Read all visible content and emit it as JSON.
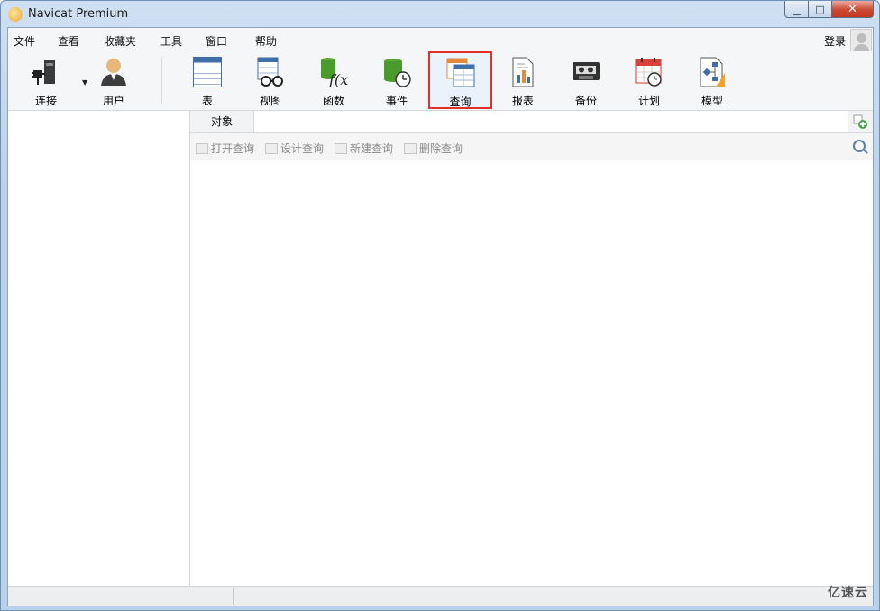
{
  "window": {
    "title": "Navicat Premium"
  },
  "menubar": {
    "items": [
      "文件",
      "查看",
      "收藏夹",
      "工具",
      "窗口",
      "帮助"
    ],
    "login_label": "登录"
  },
  "toolbar": {
    "connect": "连接",
    "user": "用户",
    "table": "表",
    "view": "视图",
    "function": "函数",
    "event": "事件",
    "query": "查询",
    "report": "报表",
    "backup": "备份",
    "schedule": "计划",
    "model": "模型",
    "active_item": "查询"
  },
  "object_tab": {
    "label": "对象"
  },
  "actions": {
    "open": "打开查询",
    "design": "设计查询",
    "new": "新建查询",
    "delete": "删除查询"
  },
  "watermark": "亿速云",
  "colors": {
    "highlight_border": "#e0312f",
    "title_bg": "#bcd2ec"
  }
}
